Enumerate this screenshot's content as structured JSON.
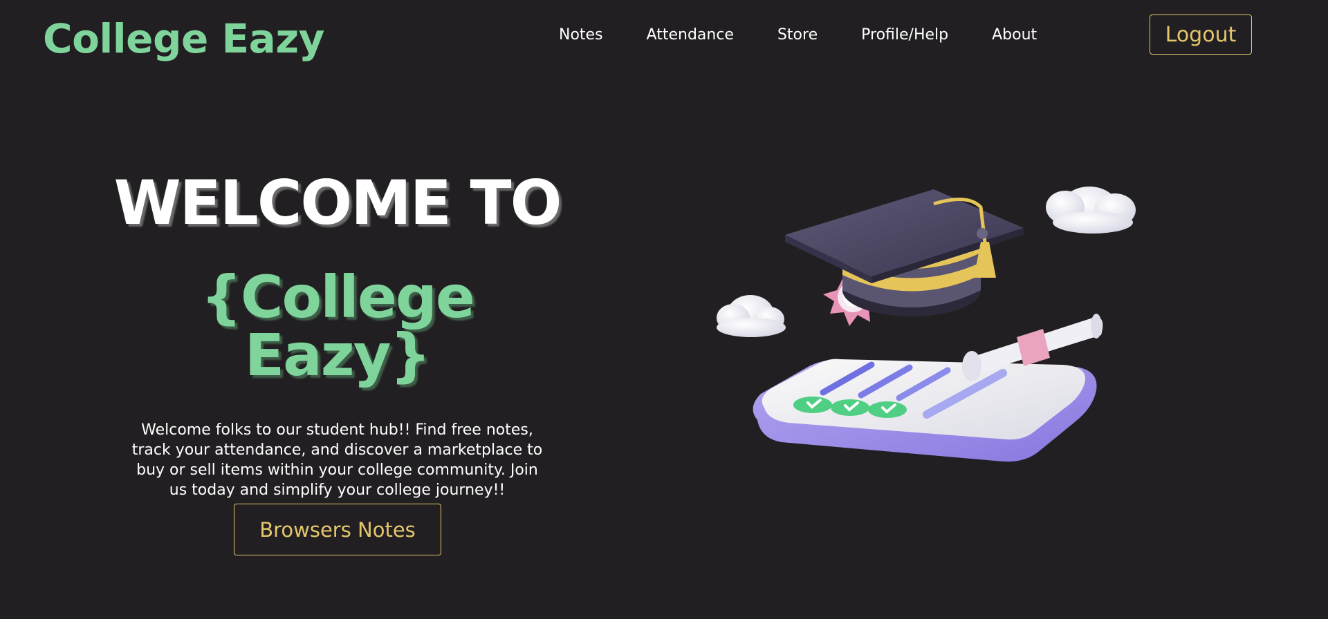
{
  "header": {
    "brand": "College Eazy",
    "nav": {
      "notes": "Notes",
      "attendance": "Attendance",
      "store": "Store",
      "profile_help": "Profile/Help",
      "about": "About"
    },
    "logout_label": "Logout"
  },
  "hero": {
    "welcome": "WELCOME TO",
    "brand": "{College Eazy}",
    "description": "Welcome folks to our student hub!! Find free notes, track your attendance, and discover a marketplace to buy or sell items within your college community. Join us today and simplify your college journey!!",
    "cta_label": "Browsers Notes"
  },
  "colors": {
    "background": "#221f22",
    "brand_green": "#7fd49b",
    "accent_gold": "#e5c76b",
    "text_white": "#ffffff"
  },
  "icons": {
    "illustration": "graduation-cap-diploma-illustration"
  }
}
